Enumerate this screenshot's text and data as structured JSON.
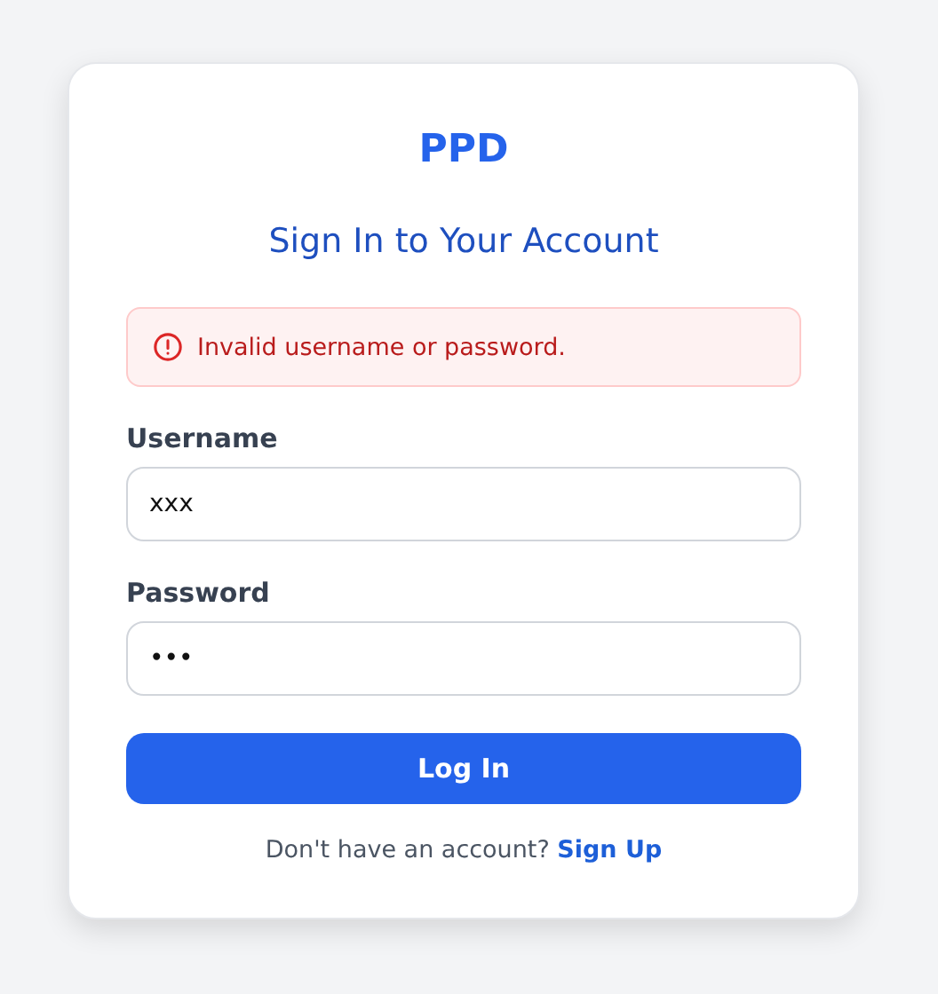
{
  "brand": "PPD",
  "heading": "Sign In to Your Account",
  "alert": {
    "kind": "error",
    "message": "Invalid username or password."
  },
  "fields": [
    {
      "label": "Username",
      "value": "xxx"
    },
    {
      "label": "Password",
      "value": "•••"
    }
  ],
  "submit": "Log In",
  "footer": {
    "prompt": "Don't have an account?",
    "link": "Sign Up"
  }
}
